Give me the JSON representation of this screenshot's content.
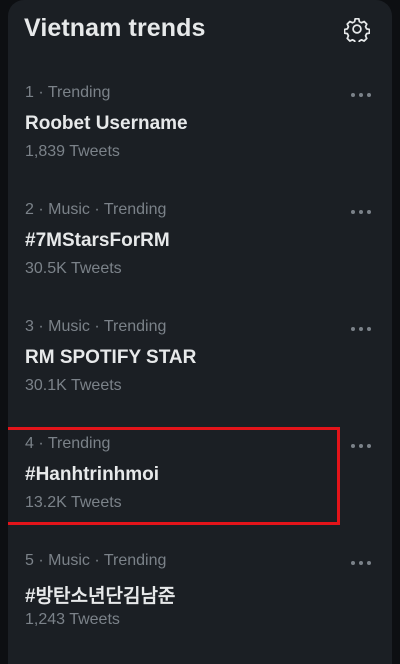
{
  "header": {
    "title": "Vietnam trends",
    "settings_icon": "gear-icon"
  },
  "trends": [
    {
      "meta": "1 · Trending",
      "name": "Roobet Username",
      "count": "1,839 Tweets"
    },
    {
      "meta": "2 · Music · Trending",
      "name": "#7MStarsForRM",
      "count": "30.5K Tweets"
    },
    {
      "meta": "3 · Music · Trending",
      "name": "RM SPOTIFY STAR",
      "count": "30.1K Tweets"
    },
    {
      "meta": "4 · Trending",
      "name": "#Hanhtrinhmoi",
      "count": "13.2K Tweets"
    },
    {
      "meta": "5 · Music · Trending",
      "name": "#방탄소년단김남준",
      "count": "1,243 Tweets"
    }
  ],
  "annotation": {
    "highlight_color": "#e3141a",
    "highlighted_trend_rank": 4
  },
  "colors": {
    "panel": "#1b1f24",
    "primary_text": "#e7e9ea",
    "secondary_text": "#7b8289"
  }
}
